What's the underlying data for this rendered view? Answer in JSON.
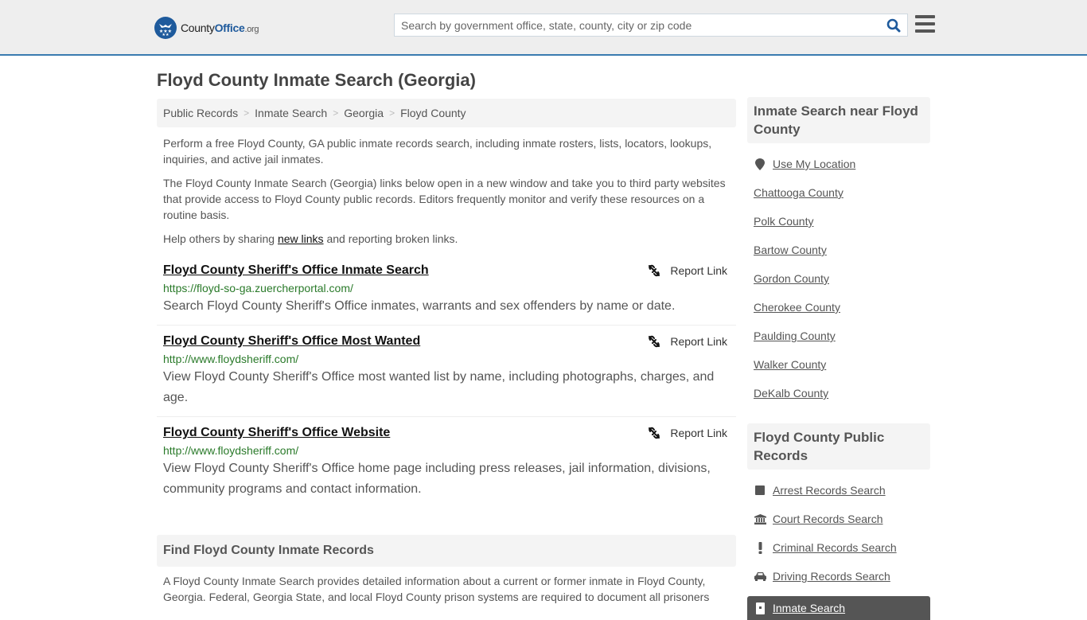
{
  "header": {
    "logo": {
      "name_part1": "County",
      "name_part2": "Office",
      "tld": ".org"
    },
    "search": {
      "placeholder": "Search by government office, state, county, city or zip code",
      "value": ""
    },
    "colors": {
      "brand": "#1e5a9c",
      "accent_border": "#3a7bb0"
    }
  },
  "page": {
    "title": "Floyd County Inmate Search (Georgia)",
    "breadcrumb": [
      "Public Records",
      "Inmate Search",
      "Georgia",
      "Floyd County"
    ],
    "intro": {
      "p1": "Perform a free Floyd County, GA public inmate records search, including inmate rosters, lists, locators, lookups, inquiries, and active jail inmates.",
      "p2": "The Floyd County Inmate Search (Georgia) links below open in a new window and take you to third party websites that provide access to Floyd County public records. Editors frequently monitor and verify these resources on a routine basis.",
      "p3_before": "Help others by sharing ",
      "p3_link": "new links",
      "p3_after": " and reporting broken links."
    },
    "report_label": "Report Link",
    "links": [
      {
        "title": "Floyd County Sheriff's Office Inmate Search",
        "url": "https://floyd-so-ga.zuercherportal.com/",
        "description": "Search Floyd County Sheriff's Office inmates, warrants and sex offenders by name or date."
      },
      {
        "title": "Floyd County Sheriff's Office Most Wanted",
        "url": "http://www.floydsheriff.com/",
        "description": "View Floyd County Sheriff's Office most wanted list by name, including photographs, charges, and age."
      },
      {
        "title": "Floyd County Sheriff's Office Website",
        "url": "http://www.floydsheriff.com/",
        "description": "View Floyd County Sheriff's Office home page including press releases, jail information, divisions, community programs and contact information."
      }
    ],
    "find_section": {
      "heading": "Find Floyd County Inmate Records",
      "body": "A Floyd County Inmate Search provides detailed information about a current or former inmate in Floyd County, Georgia. Federal, Georgia State, and local Floyd County prison systems are required to document all prisoners"
    }
  },
  "sidebar": {
    "nearby": {
      "heading": "Inmate Search near Floyd County",
      "location_label": "Use My Location",
      "counties": [
        "Chattooga County",
        "Polk County",
        "Bartow County",
        "Gordon County",
        "Cherokee County",
        "Paulding County",
        "Walker County",
        "DeKalb County"
      ]
    },
    "public_records": {
      "heading": "Floyd County Public Records",
      "items": [
        {
          "label": "Arrest Records Search",
          "icon": "square-icon"
        },
        {
          "label": "Court Records Search",
          "icon": "courthouse-icon"
        },
        {
          "label": "Criminal Records Search",
          "icon": "exclamation-icon"
        },
        {
          "label": "Driving Records Search",
          "icon": "car-icon"
        }
      ],
      "active_item": {
        "label": "Inmate Search",
        "icon": "door-icon"
      }
    }
  }
}
